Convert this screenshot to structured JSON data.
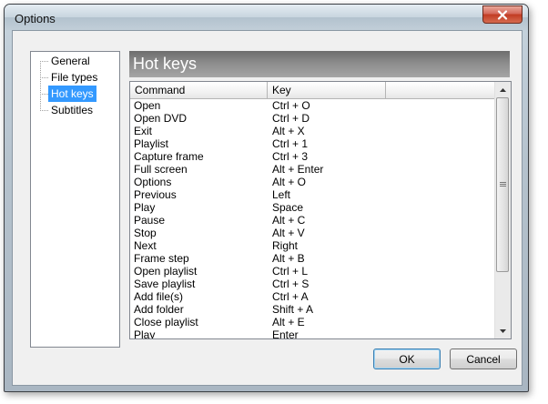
{
  "window": {
    "title": "Options",
    "close_symbol": "✕"
  },
  "tree": {
    "items": [
      {
        "label": "General",
        "selected": false
      },
      {
        "label": "File types",
        "selected": false
      },
      {
        "label": "Hot keys",
        "selected": true
      },
      {
        "label": "Subtitles",
        "selected": false
      }
    ]
  },
  "panel": {
    "header": "Hot keys",
    "columns": [
      "Command",
      "Key"
    ],
    "rows": [
      [
        "Open",
        "Ctrl + O"
      ],
      [
        "Open DVD",
        "Ctrl + D"
      ],
      [
        "Exit",
        "Alt + X"
      ],
      [
        "Playlist",
        "Ctrl + 1"
      ],
      [
        "Capture frame",
        "Ctrl + 3"
      ],
      [
        "Full screen",
        "Alt + Enter"
      ],
      [
        "Options",
        "Alt + O"
      ],
      [
        "Previous",
        "Left"
      ],
      [
        "Play",
        "Space"
      ],
      [
        "Pause",
        "Alt + C"
      ],
      [
        "Stop",
        "Alt + V"
      ],
      [
        "Next",
        "Right"
      ],
      [
        "Frame step",
        "Alt + B"
      ],
      [
        "Open playlist",
        "Ctrl + L"
      ],
      [
        "Save playlist",
        "Ctrl + S"
      ],
      [
        "Add file(s)",
        "Ctrl + A"
      ],
      [
        "Add folder",
        "Shift + A"
      ],
      [
        "Close playlist",
        "Alt + E"
      ],
      [
        "Play",
        "Enter"
      ]
    ]
  },
  "buttons": {
    "ok": "OK",
    "cancel": "Cancel"
  },
  "colors": {
    "selection": "#3399ff",
    "header_band": "#8c8c8c"
  }
}
